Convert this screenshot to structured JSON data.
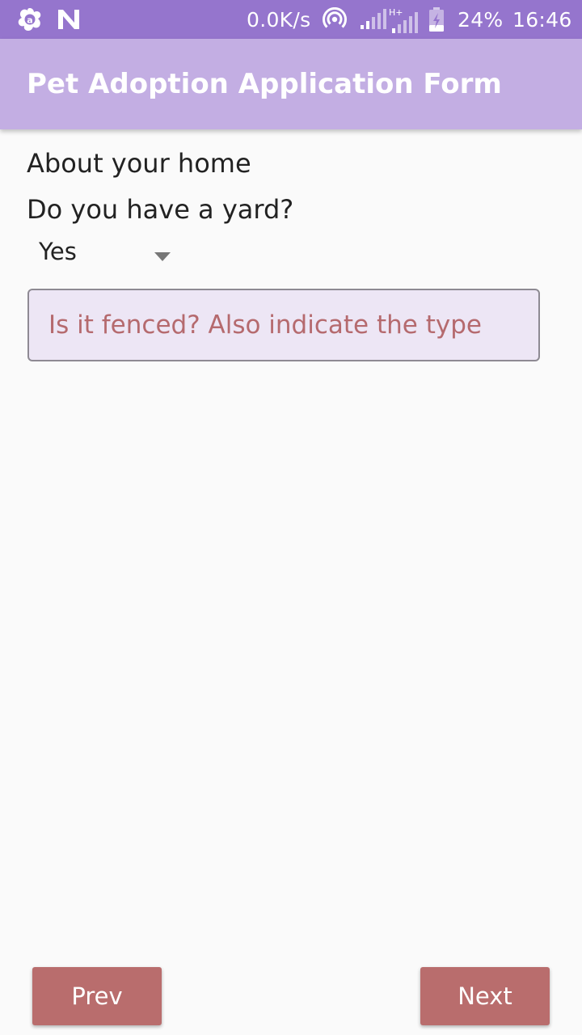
{
  "status_bar": {
    "network_speed": "0.0K/s",
    "network_type": "H+",
    "battery": "24%",
    "time": "16:46",
    "icons": [
      "avast-icon",
      "n-icon",
      "hotspot-icon",
      "signal-icon",
      "signal-h-plus-icon",
      "battery-charging-icon"
    ]
  },
  "app_bar": {
    "title": "Pet Adoption Application Form"
  },
  "form": {
    "section_title": "About your home",
    "yard_question": "Do you have a yard?",
    "yard_answer": "Yes",
    "fence_placeholder": "Is it fenced? Also indicate the type",
    "fence_value": ""
  },
  "buttons": {
    "prev": "Prev",
    "next": "Next"
  },
  "colors": {
    "status_bar": "#9575cd",
    "app_bar": "#c3aee3",
    "button": "#b96d6d",
    "placeholder": "#b56a6e",
    "field_bg": "#ede6f5"
  }
}
